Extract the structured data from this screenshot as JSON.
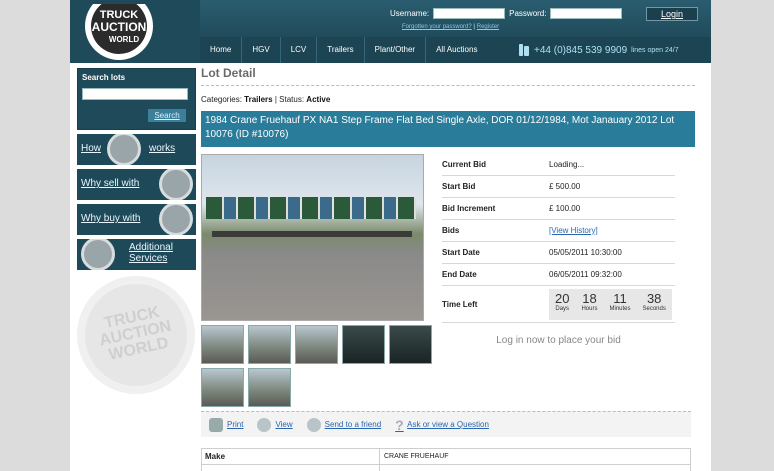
{
  "header": {
    "logo_text": [
      "TRUCK",
      "AUCTION",
      "WORLD"
    ],
    "username_label": "Username:",
    "password_label": "Password:",
    "login_label": "Login",
    "forgot_label": "Forgotten your password?",
    "separator": "|",
    "register_label": "Register",
    "nav": [
      "Home",
      "HGV",
      "LCV",
      "Trailers",
      "Plant/Other",
      "All Auctions"
    ],
    "phone": "+44 (0)845 539 9909",
    "phone_note": "lines open 24/7"
  },
  "sidebar": {
    "search_title": "Search lots",
    "search_button": "Search",
    "promos": [
      "How",
      "works",
      "Why sell with",
      "Why buy with",
      "Additional",
      "Services"
    ],
    "badge_text": [
      "TRUCK",
      "AUCTION",
      "WORLD"
    ]
  },
  "main": {
    "title": "Lot Detail",
    "categories_label": "Categories:",
    "category": "Trailers",
    "status_label": "Status:",
    "status": "Active",
    "heading": "1984 Crane Fruehauf PX NA1 Step Frame Flat Bed Single Axle, DOR 01/12/1984, Mot Janauary 2012 Lot 10076 (ID #10076)",
    "info": {
      "current_bid_label": "Current Bid",
      "current_bid": "Loading...",
      "start_bid_label": "Start Bid",
      "start_bid": "£ 500.00",
      "increment_label": "Bid Increment",
      "increment": "£ 100.00",
      "bids_label": "Bids",
      "bids": "[View History]",
      "start_date_label": "Start Date",
      "start_date": "05/05/2011 10:30:00",
      "end_date_label": "End Date",
      "end_date": "06/05/2011 09:32:00",
      "time_left_label": "Time Left"
    },
    "timer": {
      "days": "20",
      "hours": "18",
      "minutes": "11",
      "seconds": "38",
      "days_label": "Days",
      "hours_label": "Hours",
      "minutes_label": "Minutes",
      "seconds_label": "Seconds"
    },
    "login_note": "Log in now to place your bid",
    "actions": [
      "Print",
      "View",
      "Send to a friend",
      "Ask or view a Question"
    ],
    "spec": [
      {
        "label": "Make",
        "value": "CRANE FRUEHAUF"
      }
    ]
  },
  "icons": [
    "phone-icon",
    "print-icon",
    "zoom-icon",
    "send-icon",
    "question-icon"
  ]
}
